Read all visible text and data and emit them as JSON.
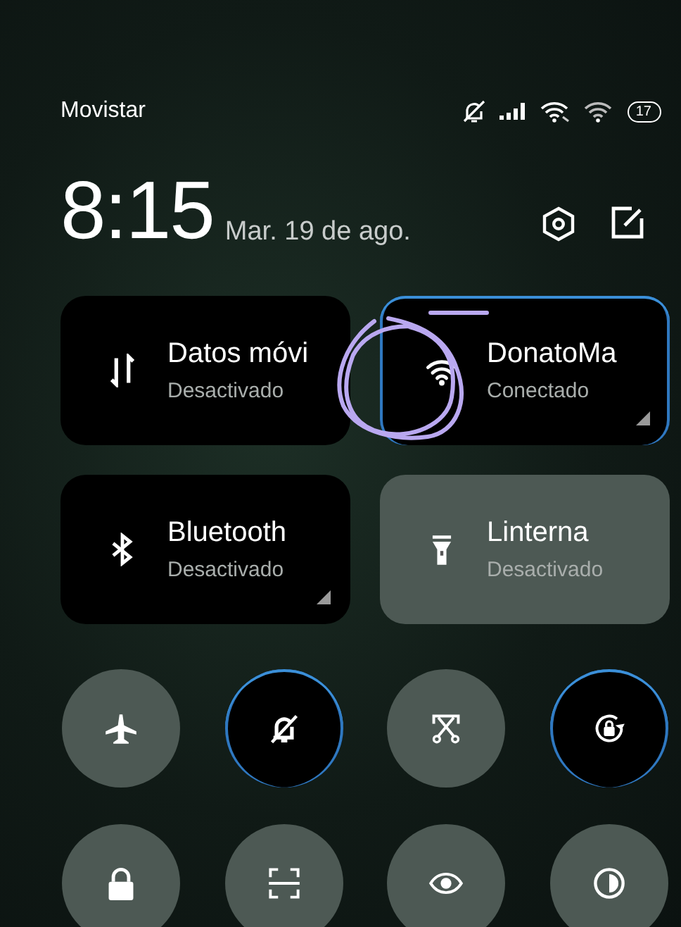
{
  "status_bar": {
    "carrier": "Movistar",
    "battery": "17"
  },
  "header": {
    "time": "8:15",
    "date": "Mar. 19 de ago."
  },
  "tiles": [
    {
      "kind": "data",
      "title": "Datos móvi",
      "subtitle": "Desactivado",
      "on": false,
      "filled": false,
      "details": false
    },
    {
      "kind": "wifi",
      "title": "DonatoMa",
      "subtitle": "Conectado",
      "on": true,
      "filled": false,
      "details": true
    },
    {
      "kind": "bluetooth",
      "title": "Bluetooth",
      "subtitle": "Desactivado",
      "on": false,
      "filled": false,
      "details": true
    },
    {
      "kind": "flashlight",
      "title": "Linterna",
      "subtitle": "Desactivado",
      "on": false,
      "filled": true,
      "details": false
    }
  ],
  "toggles": [
    {
      "kind": "airplane",
      "on": false
    },
    {
      "kind": "silent",
      "on": true
    },
    {
      "kind": "screenshot",
      "on": false
    },
    {
      "kind": "rotation",
      "on": true
    },
    {
      "kind": "lock",
      "on": false
    },
    {
      "kind": "scan",
      "on": false
    },
    {
      "kind": "eye",
      "on": false
    },
    {
      "kind": "contrast",
      "on": false
    }
  ]
}
